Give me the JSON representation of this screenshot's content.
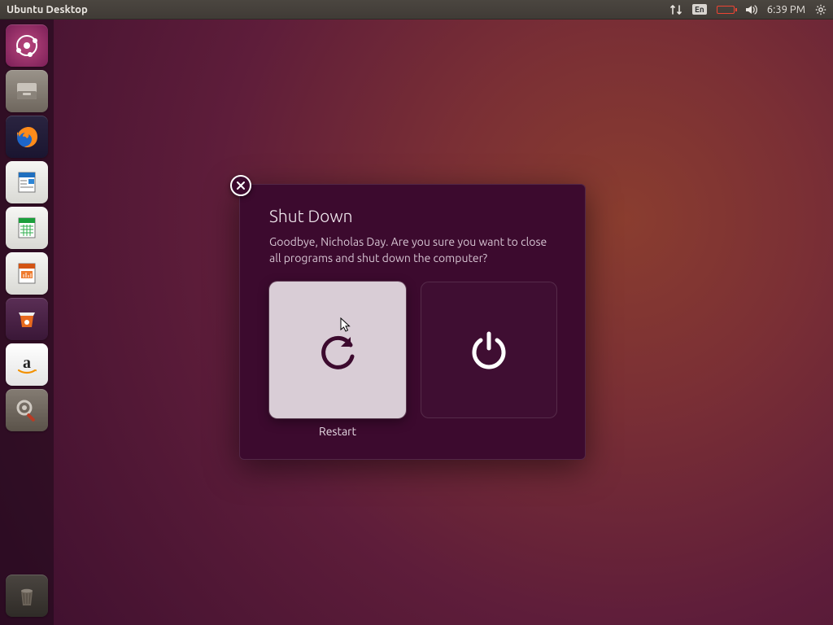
{
  "menubar": {
    "title": "Ubuntu Desktop",
    "language": "En",
    "time": "6:39 PM"
  },
  "launcher": {
    "items": [
      {
        "name": "dash",
        "bg": "radial-gradient(circle,#b9467d,#7a1f57)"
      },
      {
        "name": "files",
        "bg": "linear-gradient(#9a938a,#6e665d)"
      },
      {
        "name": "firefox",
        "bg": "linear-gradient(#1e87e5,#0d4f9e)"
      },
      {
        "name": "writer",
        "bg": "linear-gradient(#f6f6f4,#d9d9d4)"
      },
      {
        "name": "calc",
        "bg": "linear-gradient(#f6f6f4,#d9d9d4)"
      },
      {
        "name": "impress",
        "bg": "linear-gradient(#f6f6f4,#d9d9d4)"
      },
      {
        "name": "software",
        "bg": "linear-gradient(#5a2e55,#3a1737)"
      },
      {
        "name": "amazon",
        "bg": "linear-gradient(#ffffff,#e4e4e4)"
      },
      {
        "name": "settings",
        "bg": "linear-gradient(#847c73,#5a5249)"
      }
    ],
    "trash": {
      "name": "trash",
      "bg": "linear-gradient(#4a4540,#2f2b27)"
    }
  },
  "dialog": {
    "title": "Shut Down",
    "message": "Goodbye, Nicholas Day. Are you sure you want to close all programs and shut down the computer?",
    "restart_label": "Restart",
    "shutdown_label": ""
  }
}
